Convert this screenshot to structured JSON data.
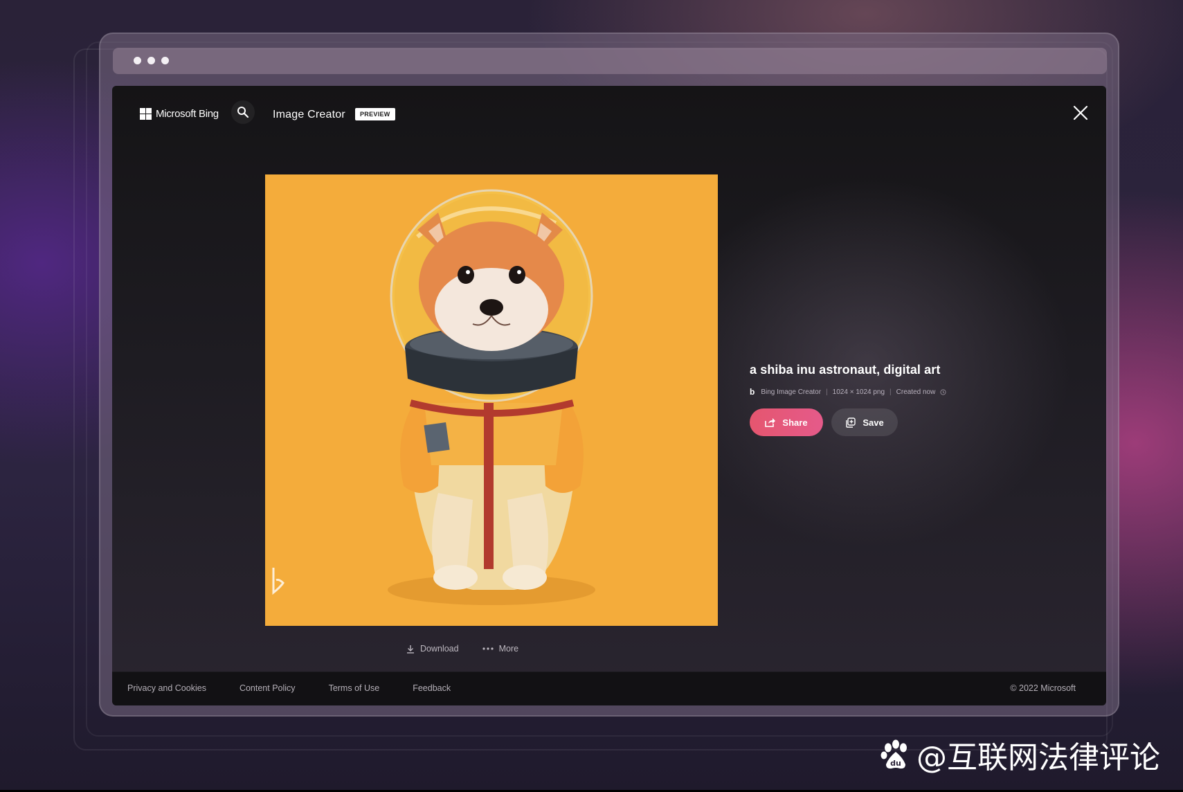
{
  "header": {
    "brand": "Microsoft Bing",
    "app_title": "Image Creator",
    "badge": "PREVIEW"
  },
  "image": {
    "subject": "shiba inu astronaut",
    "background_color": "#f4ac3b",
    "corner_mark": "b"
  },
  "image_actions": {
    "download_label": "Download",
    "more_label": "More"
  },
  "details": {
    "prompt": "a shiba inu astronaut, digital art",
    "source": "Bing Image Creator",
    "resolution": "1024 × 1024 png",
    "created": "Created now",
    "share_label": "Share",
    "save_label": "Save"
  },
  "footer": {
    "links": [
      "Privacy and Cookies",
      "Content Policy",
      "Terms of Use",
      "Feedback"
    ],
    "copyright": "© 2022 Microsoft"
  },
  "watermark": {
    "text": "@互联网法律评论"
  },
  "colors": {
    "accent_pink": "#e5566f",
    "page_dark": "#151416",
    "image_bg": "#f4ac3b"
  }
}
